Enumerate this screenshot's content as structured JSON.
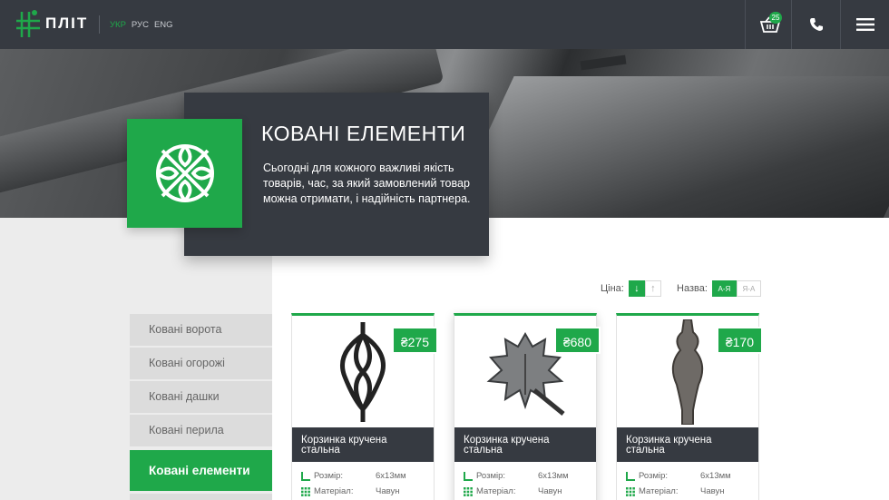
{
  "header": {
    "logo_text": "ПЛІТ",
    "languages": [
      "УКР",
      "РУС",
      "ENG"
    ],
    "active_language": "УКР",
    "cart_count": "25"
  },
  "hero": {
    "title": "КОВАНІ ЕЛЕМЕНТИ",
    "description": "Сьогодні для кожного важливі якість товарів, час, за який замовлений товар можна отримати, і надійність партнера."
  },
  "sort": {
    "price_label": "Ціна:",
    "price_asc": "↓",
    "price_desc": "↑",
    "name_label": "Назва:",
    "name_az": "А-Я",
    "name_za": "Я-А"
  },
  "sidebar": {
    "items": [
      {
        "label": "Ковані ворота"
      },
      {
        "label": "Ковані огорожі"
      },
      {
        "label": "Ковані дашки"
      },
      {
        "label": "Ковані перила"
      },
      {
        "label": "Ковані елементи"
      }
    ]
  },
  "products": [
    {
      "price": "₴275",
      "name": "Корзинка кручена стальна",
      "size_label": "Розмір:",
      "size": "6х13мм",
      "material_label": "Матеріал:",
      "material": "Чавун"
    },
    {
      "price": "₴680",
      "name": "Корзинка кручена стальна",
      "size_label": "Розмір:",
      "size": "6х13мм",
      "material_label": "Матеріал:",
      "material": "Чавун"
    },
    {
      "price": "₴170",
      "name": "Корзинка кручена стальна",
      "size_label": "Розмір:",
      "size": "6х13мм",
      "material_label": "Матеріал:",
      "material": "Чавун"
    }
  ],
  "colors": {
    "accent": "#1fa84a",
    "dark": "#363a41"
  }
}
